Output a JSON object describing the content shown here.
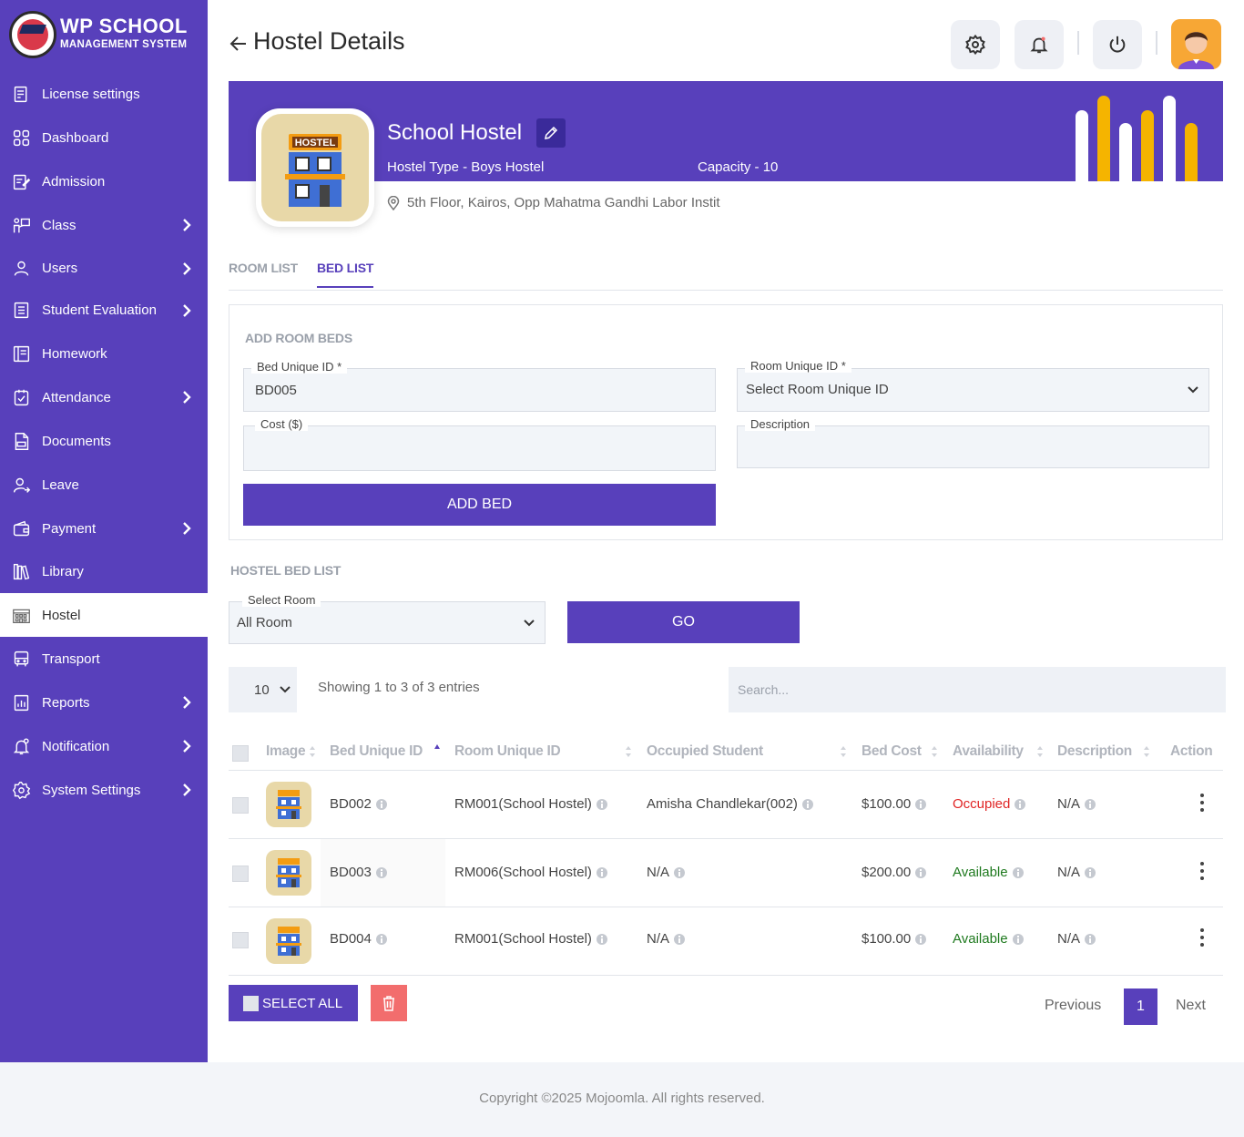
{
  "app": {
    "logo_title": "WP SCHOOL",
    "logo_subtitle": "MANAGEMENT SYSTEM",
    "accent_color": "#5840bb"
  },
  "sidebar": {
    "items": [
      {
        "label": "License settings",
        "icon": "license-icon",
        "has_submenu": false
      },
      {
        "label": "Dashboard",
        "icon": "dashboard-icon",
        "has_submenu": false
      },
      {
        "label": "Admission",
        "icon": "admission-icon",
        "has_submenu": false
      },
      {
        "label": "Class",
        "icon": "class-icon",
        "has_submenu": true
      },
      {
        "label": "Users",
        "icon": "user-icon",
        "has_submenu": true
      },
      {
        "label": "Student Evaluation",
        "icon": "evaluation-icon",
        "has_submenu": true
      },
      {
        "label": "Homework",
        "icon": "homework-icon",
        "has_submenu": false
      },
      {
        "label": "Attendance",
        "icon": "attendance-icon",
        "has_submenu": true
      },
      {
        "label": "Documents",
        "icon": "documents-icon",
        "has_submenu": false
      },
      {
        "label": "Leave",
        "icon": "leave-icon",
        "has_submenu": false
      },
      {
        "label": "Payment",
        "icon": "payment-icon",
        "has_submenu": true
      },
      {
        "label": "Library",
        "icon": "library-icon",
        "has_submenu": false
      },
      {
        "label": "Hostel",
        "icon": "hostel-icon",
        "has_submenu": false,
        "active": true
      },
      {
        "label": "Transport",
        "icon": "transport-icon",
        "has_submenu": false
      },
      {
        "label": "Reports",
        "icon": "reports-icon",
        "has_submenu": true
      },
      {
        "label": "Notification",
        "icon": "notification-icon",
        "has_submenu": true
      },
      {
        "label": "System Settings",
        "icon": "settings-icon",
        "has_submenu": true
      }
    ]
  },
  "header": {
    "title": "Hostel Details"
  },
  "hostel": {
    "name": "School Hostel",
    "image_label": "HOSTEL",
    "type": "Hostel Type - Boys Hostel",
    "capacity": "Capacity - 10",
    "address": "5th Floor, Kairos, Opp Mahatma Gandhi Labor Instit"
  },
  "tabs": [
    {
      "label": "ROOM LIST",
      "active": false
    },
    {
      "label": "BED LIST",
      "active": true
    }
  ],
  "form": {
    "title": "ADD ROOM BEDS",
    "bed_id": {
      "label": "Bed Unique ID *",
      "value": "BD005"
    },
    "room_id": {
      "label": "Room Unique ID *",
      "value": "Select Room Unique ID"
    },
    "cost": {
      "label": "Cost ($)",
      "value": ""
    },
    "description": {
      "label": "Description",
      "value": ""
    },
    "submit_label": "ADD BED"
  },
  "bed_list": {
    "title": "HOSTEL BED LIST",
    "select_room": {
      "label": "Select Room",
      "value": "All Room"
    },
    "go_label": "GO",
    "page_length": "10",
    "showing": "Showing 1 to 3 of 3 entries",
    "search_placeholder": "Search..."
  },
  "table": {
    "columns": [
      "Image",
      "Bed Unique ID",
      "Room Unique ID",
      "Occupied Student",
      "Bed Cost",
      "Availability",
      "Description",
      "Action"
    ],
    "rows": [
      {
        "bed_id": "BD002",
        "room_id": "RM001(School Hostel)",
        "student": "Amisha Chandlekar(002)",
        "cost": "$100.00",
        "availability": "Occupied",
        "description": "N/A"
      },
      {
        "bed_id": "BD003",
        "room_id": "RM006(School Hostel)",
        "student": "N/A",
        "cost": "$200.00",
        "availability": "Available",
        "description": "N/A"
      },
      {
        "bed_id": "BD004",
        "room_id": "RM001(School Hostel)",
        "student": "N/A",
        "cost": "$100.00",
        "availability": "Available",
        "description": "N/A"
      }
    ],
    "status_colors": {
      "Occupied": "#e02424",
      "Available": "#1f7a1f"
    }
  },
  "actions": {
    "select_all_label": "SELECT ALL",
    "delete_icon": "trash-icon"
  },
  "pagination": {
    "previous_label": "Previous",
    "current_page": "1",
    "next_label": "Next"
  },
  "footer": {
    "copyright": "Copyright ©2025 Mojoomla. All rights reserved."
  }
}
